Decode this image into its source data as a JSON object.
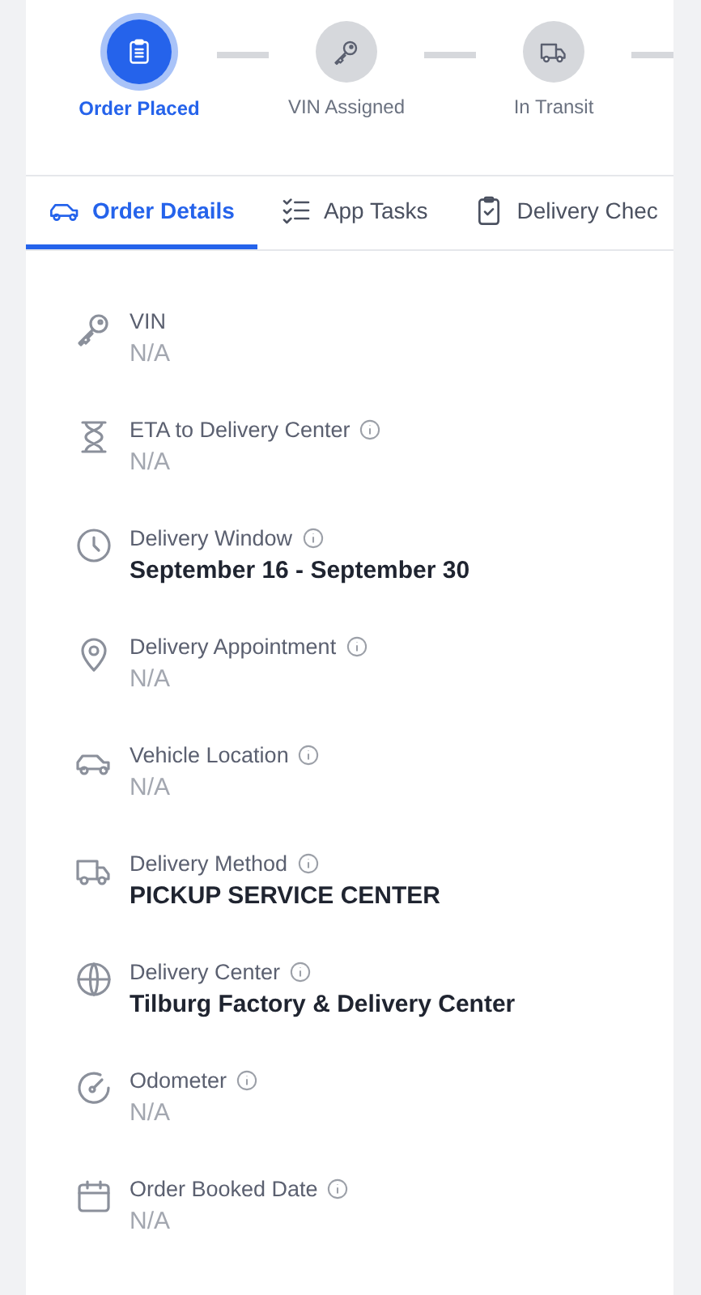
{
  "steps": [
    {
      "label": "Order Placed",
      "selected": true
    },
    {
      "label": "VIN Assigned",
      "selected": false
    },
    {
      "label": "In Transit",
      "selected": false
    }
  ],
  "tabs": [
    {
      "label": "Order Details",
      "selected": true
    },
    {
      "label": "App Tasks",
      "selected": false
    },
    {
      "label": "Delivery Chec",
      "selected": false
    }
  ],
  "details": [
    {
      "label": "VIN",
      "value": "N/A",
      "info": false,
      "kind": "empty"
    },
    {
      "label": "ETA to Delivery Center",
      "value": "N/A",
      "info": true,
      "kind": "empty"
    },
    {
      "label": "Delivery Window",
      "value": "September 16 - September 30",
      "info": true,
      "kind": "set"
    },
    {
      "label": "Delivery Appointment",
      "value": "N/A",
      "info": true,
      "kind": "empty"
    },
    {
      "label": "Vehicle Location",
      "value": "N/A",
      "info": true,
      "kind": "empty"
    },
    {
      "label": "Delivery Method",
      "value": "PICKUP SERVICE CENTER",
      "info": true,
      "kind": "set"
    },
    {
      "label": "Delivery Center",
      "value": "Tilburg Factory & Delivery Center",
      "info": true,
      "kind": "set"
    },
    {
      "label": "Odometer",
      "value": "N/A",
      "info": true,
      "kind": "empty"
    },
    {
      "label": "Order Booked Date",
      "value": "N/A",
      "info": true,
      "kind": "empty"
    }
  ]
}
